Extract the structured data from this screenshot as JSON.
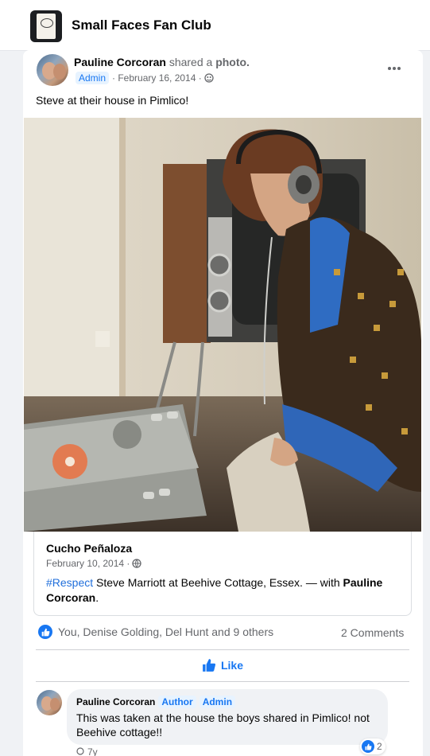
{
  "group": {
    "title": "Small Faces Fan Club",
    "thumb_icon": "group-cover-icon"
  },
  "post": {
    "author": "Pauline Corcoran",
    "action_text": "shared a",
    "action_object": "photo.",
    "badge": "Admin",
    "date": "· February 16, 2014 ·",
    "audience_icon": "members-icon",
    "text": "Steve at their house in Pimlico!",
    "photo_icon": "photo-steve-headphones"
  },
  "shared": {
    "author": "Cucho Peñaloza",
    "date": "February 10, 2014 ·",
    "audience_icon": "globe-icon",
    "hashtag": "#Respect",
    "caption": " Steve Marriott at Beehive Cottage, Essex. — with ",
    "tagged": "Pauline Corcoran",
    "period": "."
  },
  "reactions": {
    "summary": "You, Denise Golding, Del Hunt and 9 others",
    "comments": "2 Comments"
  },
  "actions": {
    "like_label": "Like"
  },
  "comment": {
    "author": "Pauline Corcoran",
    "badge_author": "Author",
    "badge_admin": "Admin",
    "text": "This was taken at the house the boys shared in Pimlico! not Beehive cottage!!",
    "reaction_count": "2",
    "time": "7y"
  },
  "colors": {
    "accent": "#1877f2",
    "background": "#f0f2f5",
    "badge_bg": "#e7f3ff"
  }
}
